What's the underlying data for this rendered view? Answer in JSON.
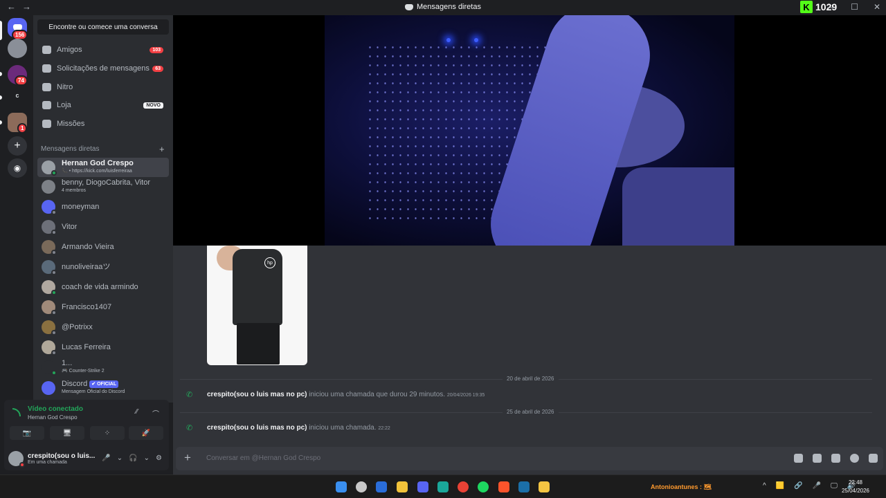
{
  "titlebar": {
    "title": "Mensagens diretas",
    "back": "←",
    "forward": "→",
    "kick_count": "1029",
    "minimize": "—",
    "maximize": "☐",
    "close": "✕"
  },
  "servers": [
    {
      "name": "discord-home",
      "badge": "156",
      "color": "#5865f2"
    },
    {
      "name": "server-avatar-1",
      "badge": "",
      "color": "#8a8f98"
    },
    {
      "name": "server-avatar-2",
      "badge": "74",
      "color": "#6b2a7b"
    },
    {
      "name": "server-c",
      "label": "c",
      "badge": "",
      "color": "#1e1f22"
    },
    {
      "name": "server-avatar-3",
      "badge": "1",
      "color": "#8c6b5a"
    }
  ],
  "dm_sidebar": {
    "search": "Encontre ou comece uma conversa",
    "nav": [
      {
        "label": "Amigos",
        "badge": "103"
      },
      {
        "label": "Solicitações de mensagens",
        "badge": "63"
      },
      {
        "label": "Nitro",
        "badge": ""
      },
      {
        "label": "Loja",
        "badge": "NOVO"
      },
      {
        "label": "Missões",
        "badge": ""
      }
    ],
    "section_title": "Mensagens diretas",
    "section_plus": "+",
    "dms": [
      {
        "name": "Hernan God Crespo",
        "sub": "📞 • https://kick.com/luisferreiraa",
        "status": "on",
        "active": true,
        "color": "#9aa0a6"
      },
      {
        "name": "benny, DiogoCabrita, Vitor",
        "sub": "4 membros",
        "status": "",
        "color": "#7d8187"
      },
      {
        "name": "moneyman",
        "sub": "",
        "status": "off",
        "color": "#5865f2"
      },
      {
        "name": "Vitor",
        "sub": "",
        "status": "off",
        "color": "#6d7079"
      },
      {
        "name": "Armando Vieira",
        "sub": "",
        "status": "off",
        "color": "#7a6a5a"
      },
      {
        "name": "nunoliveiraaツ",
        "sub": "",
        "status": "off",
        "color": "#5a6a7a"
      },
      {
        "name": "coach de vida armindo",
        "sub": "",
        "status": "on",
        "color": "#b0a8a0"
      },
      {
        "name": "Francisco1407",
        "sub": "",
        "status": "off",
        "color": "#a08a7a"
      },
      {
        "name": "@Potrixx",
        "sub": "",
        "status": "off",
        "color": "#8a7040"
      },
      {
        "name": "Lucas Ferreira",
        "sub": "",
        "status": "off",
        "color": "#b0a89a"
      },
      {
        "name": "1...",
        "sub": "🎮 Counter-Strike 2",
        "status": "on",
        "color": "#2b2d31"
      },
      {
        "name": "Discord",
        "sub": "Mensagem Oficial do Discord",
        "status": "",
        "tag": "✔ OFICIAL",
        "color": "#5865f2"
      }
    ]
  },
  "voice": {
    "title": "Vídeo conectado",
    "channel": "Hernan God Crespo",
    "buttons": [
      "📷",
      "🖥",
      "⁘",
      "🚀"
    ]
  },
  "user": {
    "name": "crespito(sou o luis...",
    "status": "Em uma chamada",
    "mic": "🎤",
    "headset": "🎧",
    "settings": "⚙"
  },
  "chat": {
    "dividers": [
      "20 de abril de 2026",
      "25 de abril de 2026"
    ],
    "calls": [
      {
        "who": "crespito(sou o luis mas no pc)",
        "text": "iniciou uma chamada que durou 29 minutos.",
        "time": "20/04/2026 19:35"
      },
      {
        "who": "crespito(sou o luis mas no pc)",
        "text": "iniciou uma chamada.",
        "time": "22:22"
      }
    ],
    "placeholder": "Conversar em @Hernan God Crespo",
    "sticker_logo": "hp"
  },
  "taskbar": {
    "apps": [
      {
        "name": "windows-start",
        "color": "#3a8ff0"
      },
      {
        "name": "shield-app",
        "color": "#c8c8c8"
      },
      {
        "name": "copilot",
        "color": "#2a6dd9"
      },
      {
        "name": "file-explorer",
        "color": "#f2c33a"
      },
      {
        "name": "discord",
        "color": "#5865f2"
      },
      {
        "name": "teal-app",
        "color": "#1aa89a"
      },
      {
        "name": "chrome",
        "color": "#e94235"
      },
      {
        "name": "spotify",
        "color": "#1ed760"
      },
      {
        "name": "brave",
        "color": "#fb542b"
      },
      {
        "name": "steam",
        "color": "#1b6fa8"
      },
      {
        "name": "notes-app",
        "color": "#f5c542"
      }
    ],
    "whatsapp_text": "Antonioantunes : 🗺",
    "tray": [
      "^",
      "🟨",
      "🔗",
      "🎤",
      "🖵",
      "🔊"
    ],
    "time": "22:48",
    "date": "25/04/2026"
  }
}
